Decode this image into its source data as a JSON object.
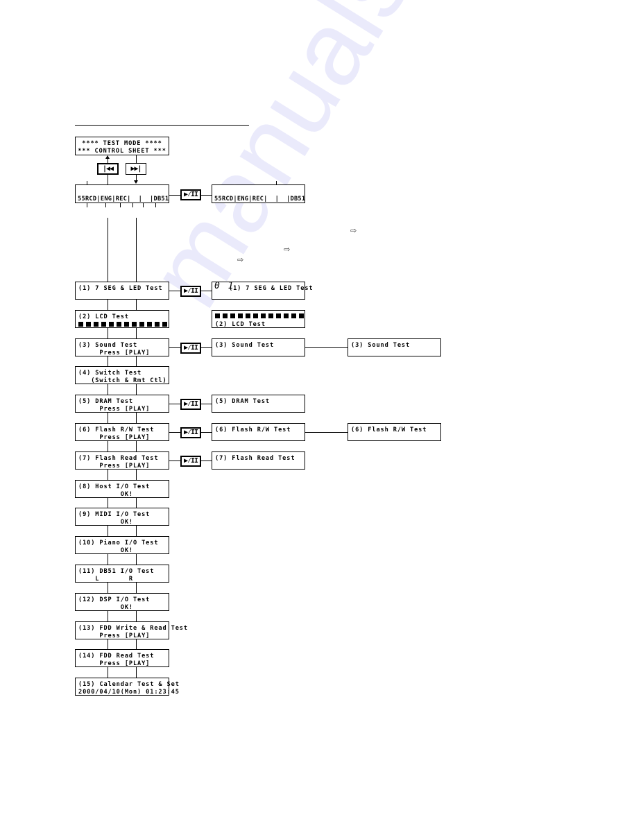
{
  "watermark": "manualshive.com",
  "top_box": {
    "line1": "**** TEST MODE ****",
    "line2": "*** CONTROL SHEET ***"
  },
  "buttons": {
    "prev": {
      "icon": "skip-back-icon",
      "glyph": "|◀◀"
    },
    "next": {
      "icon": "skip-forward-icon",
      "glyph": "▶▶|"
    },
    "play_pause": {
      "icon": "play-pause-icon",
      "glyph": "▶⁄II"
    }
  },
  "status_display": {
    "line2": "55RCD|ENG|REC|  |  |DB51"
  },
  "status_display_after": {
    "line2": "55RCD|ENG|REC|  |  |DB51"
  },
  "implies_glyph": "⇨",
  "tests": [
    {
      "line1": "(1) 7 SEG & LED Test",
      "line2": "",
      "result": {
        "prefix": "0 1",
        "line1": "(1) 7 SEG & LED Test",
        "line2": ""
      }
    },
    {
      "line1": "(2) LCD Test",
      "line2": "",
      "blocks": 12,
      "result": {
        "line1": "",
        "line2": "(2) LCD Test",
        "blocks": 12
      }
    },
    {
      "line1": "(3) Sound Test",
      "line2": "     Press [PLAY]",
      "result": {
        "line1": "(3) Sound Test",
        "line2": ""
      },
      "result2": {
        "line1": "(3) Sound Test",
        "line2": ""
      }
    },
    {
      "line1": "(4) Switch Test",
      "line2": "   (Switch & Rmt Ctl)"
    },
    {
      "line1": "(5) DRAM Test",
      "line2": "     Press [PLAY]",
      "result": {
        "line1": "(5) DRAM Test",
        "line2": ""
      }
    },
    {
      "line1": "(6) Flash R/W Test",
      "line2": "     Press [PLAY]",
      "result": {
        "line1": "(6) Flash R/W Test",
        "line2": ""
      },
      "result2": {
        "line1": "(6) Flash R/W Test",
        "line2": ""
      }
    },
    {
      "line1": "(7) Flash Read Test",
      "line2": "     Press [PLAY]",
      "result": {
        "line1": "(7) Flash Read Test",
        "line2": ""
      }
    },
    {
      "line1": "(8) Host I/O Test",
      "line2": "          OK!"
    },
    {
      "line1": "(9) MIDI I/O Test",
      "line2": "          OK!"
    },
    {
      "line1": "(10) Piano I/O Test",
      "line2": "          OK!"
    },
    {
      "line1": "(11) DB51 I/O Test",
      "line2": "    L       R"
    },
    {
      "line1": "(12) DSP I/O Test",
      "line2": "          OK!"
    },
    {
      "line1": "(13) FDD Write & Read Test",
      "line2": "     Press [PLAY]"
    },
    {
      "line1": "(14) FDD Read Test",
      "line2": "     Press [PLAY]"
    },
    {
      "line1": "(15) Calendar Test & Set",
      "line2": "2000/04/10(Mon) 01:23:45"
    }
  ]
}
